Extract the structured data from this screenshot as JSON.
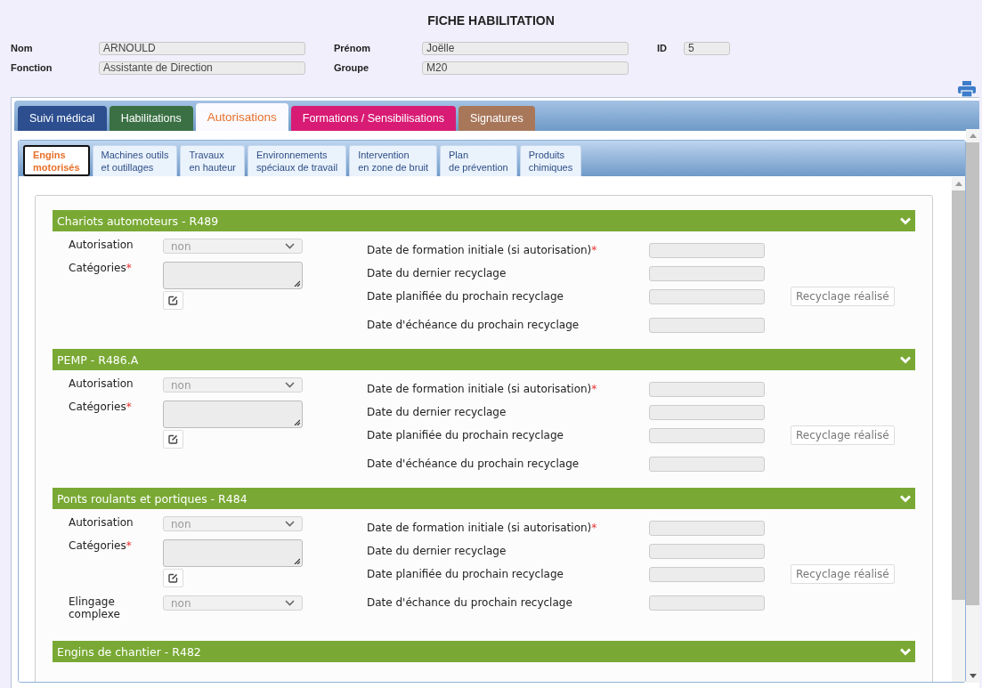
{
  "title": "FICHE HABILITATION",
  "identity": [
    [
      {
        "label": "Nom",
        "value": "ARNOULD"
      },
      {
        "label": "Prénom",
        "value": "Joëlle"
      },
      {
        "label": "ID",
        "value": "5"
      }
    ],
    [
      {
        "label": "Fonction",
        "value": "Assistante de Direction"
      },
      {
        "label": "Groupe",
        "value": "M20"
      }
    ]
  ],
  "tabs": [
    {
      "label": "Suivi médical",
      "color": "#2d4f8f",
      "selected": false
    },
    {
      "label": "Habilitations",
      "color": "#3a7043",
      "selected": false
    },
    {
      "label": "Autorisations",
      "color": "#e8702a",
      "selected": true
    },
    {
      "label": "Formations / Sensibilisations",
      "color": "#d81b74",
      "selected": false
    },
    {
      "label": "Signatures",
      "color": "#a8775a",
      "selected": false
    }
  ],
  "subtabs": [
    {
      "lines": [
        "Engins",
        "motorisés"
      ],
      "selected": true
    },
    {
      "lines": [
        "Machines outils",
        "et outillages"
      ],
      "selected": false
    },
    {
      "lines": [
        "Travaux",
        "en hauteur"
      ],
      "selected": false
    },
    {
      "lines": [
        "Environnements",
        "spéciaux de travail"
      ],
      "selected": false
    },
    {
      "lines": [
        "Intervention",
        "en zone de bruit"
      ],
      "selected": false
    },
    {
      "lines": [
        "Plan",
        "de prévention"
      ],
      "selected": false
    },
    {
      "lines": [
        "Produits",
        "chimiques"
      ],
      "selected": false
    }
  ],
  "sections": [
    {
      "title": "Chariots automoteurs - R489",
      "left": [
        {
          "kind": "select",
          "label": "Autorisation",
          "value": "non"
        },
        {
          "kind": "categories",
          "label": "Catégories",
          "mark": "*"
        }
      ],
      "dates": [
        {
          "label": "Date de formation initiale (si autorisation)",
          "mark": "*"
        },
        {
          "label": "Date du dernier recyclage"
        },
        {
          "label": "Date planifiée du prochain recyclage",
          "action": "Recyclage réalisé"
        },
        {
          "label": "Date d'échéance du prochain recyclage"
        }
      ]
    },
    {
      "title": "PEMP - R486.A",
      "left": [
        {
          "kind": "select",
          "label": "Autorisation",
          "value": "non"
        },
        {
          "kind": "categories",
          "label": "Catégories",
          "mark": "*"
        }
      ],
      "dates": [
        {
          "label": "Date de formation initiale (si autorisation)",
          "mark": "*"
        },
        {
          "label": "Date du dernier recyclage"
        },
        {
          "label": "Date planifiée du prochain recyclage",
          "action": "Recyclage réalisé"
        },
        {
          "label": "Date d'échéance du prochain recyclage"
        }
      ]
    },
    {
      "title": "Ponts roulants et portiques - R484",
      "left": [
        {
          "kind": "select",
          "label": "Autorisation",
          "value": "non"
        },
        {
          "kind": "categories",
          "label": "Catégories",
          "mark": "*"
        },
        {
          "kind": "select",
          "label": "Elingage complexe",
          "value": "non"
        }
      ],
      "dates": [
        {
          "label": "Date de formation initiale (si autorisation)",
          "mark": "*"
        },
        {
          "label": "Date du dernier recyclage"
        },
        {
          "label": "Date planifiée du prochain recyclage",
          "action": "Recyclage réalisé"
        },
        {
          "label": "Date d'échance du prochain recyclage"
        }
      ]
    },
    {
      "title": "Engins de chantier - R482"
    }
  ]
}
